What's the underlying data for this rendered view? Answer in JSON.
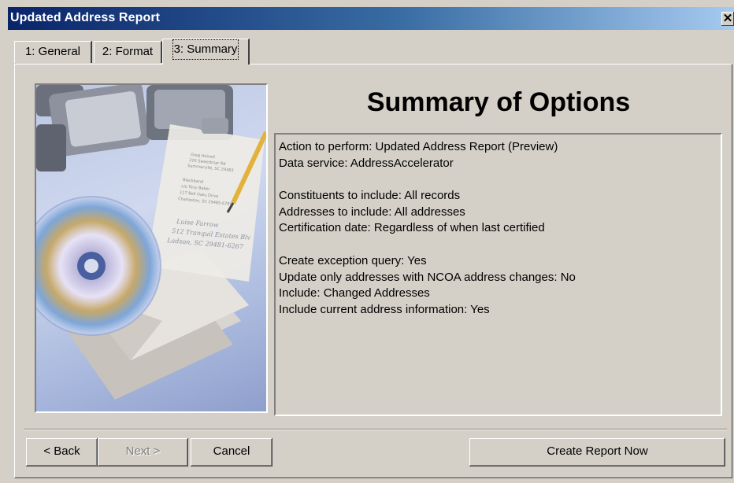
{
  "window": {
    "title": "Updated Address Report",
    "close_glyph": "✕"
  },
  "tabs": [
    {
      "label": "1: General",
      "active": false
    },
    {
      "label": "2: Format",
      "active": false
    },
    {
      "label": "3: Summary",
      "active": true
    }
  ],
  "summary": {
    "heading": "Summary of Options",
    "lines": [
      "Action to perform:  Updated Address Report (Preview)",
      "Data service:  AddressAccelerator",
      "Constituents to include:  All records",
      "Addresses to include:  All addresses",
      "Certification date:  Regardless of when last certified",
      "Create exception query:  Yes",
      "Update only addresses with NCOA address changes:  No",
      "Include:  Changed Addresses",
      "Include current address information:  Yes"
    ]
  },
  "image_envelope_text": [
    "Luise Farrow",
    "512 Tranquil Estates Blv",
    "Ladson, SC 29481-6267"
  ],
  "buttons": {
    "back": "< Back",
    "next": "Next >",
    "cancel": "Cancel",
    "create": "Create Report Now"
  }
}
